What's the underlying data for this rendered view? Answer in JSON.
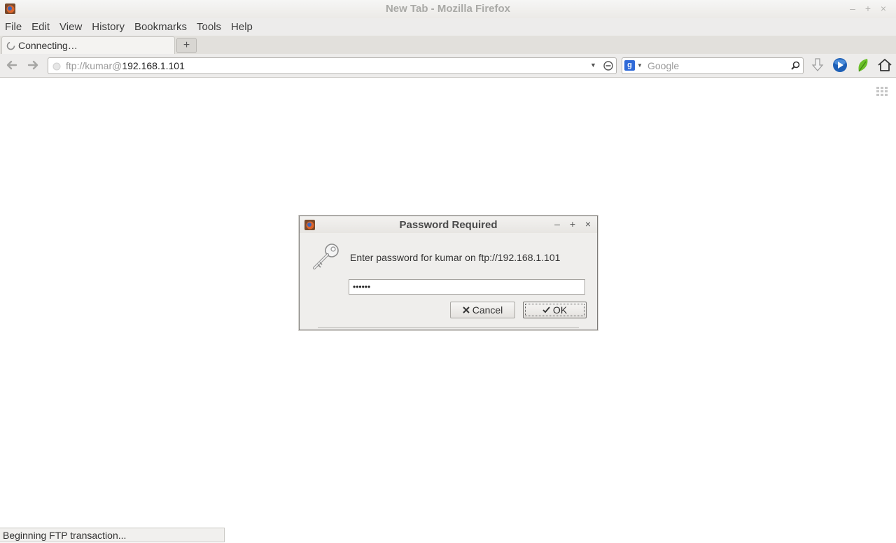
{
  "window": {
    "title": "New Tab - Mozilla Firefox",
    "controls": [
      "–",
      "+",
      "×"
    ]
  },
  "menubar": {
    "items": [
      "File",
      "Edit",
      "View",
      "History",
      "Bookmarks",
      "Tools",
      "Help"
    ]
  },
  "tabs": [
    {
      "label": "Connecting…",
      "loading": true
    }
  ],
  "newtab": {
    "label": "+"
  },
  "navbar": {
    "url_prefix": "ftp://kumar@",
    "url_host": "192.168.1.101",
    "search_placeholder": "Google"
  },
  "dialog": {
    "title": "Password Required",
    "prompt": "Enter password for kumar on ftp://192.168.1.101",
    "password_masked": "••••••",
    "cancel_label": "Cancel",
    "ok_label": "OK",
    "controls": [
      "–",
      "+",
      "×"
    ]
  },
  "status": {
    "text": "Beginning FTP transaction..."
  },
  "colors": {
    "accent_blue": "#2f6ad8",
    "chrome_bg": "#edeceb",
    "title_text": "#a9a9a6"
  }
}
